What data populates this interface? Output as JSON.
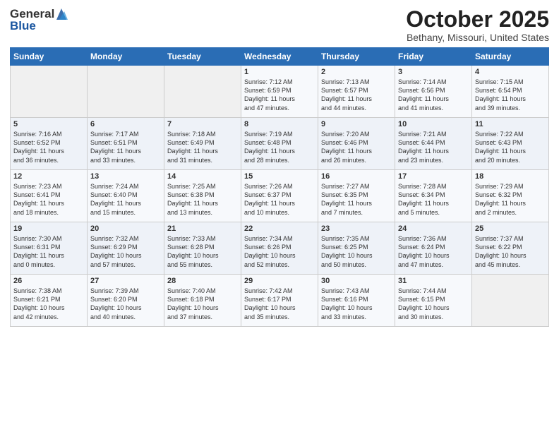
{
  "header": {
    "logo_line1": "General",
    "logo_line2": "Blue",
    "month": "October 2025",
    "location": "Bethany, Missouri, United States"
  },
  "days_of_week": [
    "Sunday",
    "Monday",
    "Tuesday",
    "Wednesday",
    "Thursday",
    "Friday",
    "Saturday"
  ],
  "weeks": [
    [
      {
        "day": "",
        "info": ""
      },
      {
        "day": "",
        "info": ""
      },
      {
        "day": "",
        "info": ""
      },
      {
        "day": "1",
        "info": "Sunrise: 7:12 AM\nSunset: 6:59 PM\nDaylight: 11 hours\nand 47 minutes."
      },
      {
        "day": "2",
        "info": "Sunrise: 7:13 AM\nSunset: 6:57 PM\nDaylight: 11 hours\nand 44 minutes."
      },
      {
        "day": "3",
        "info": "Sunrise: 7:14 AM\nSunset: 6:56 PM\nDaylight: 11 hours\nand 41 minutes."
      },
      {
        "day": "4",
        "info": "Sunrise: 7:15 AM\nSunset: 6:54 PM\nDaylight: 11 hours\nand 39 minutes."
      }
    ],
    [
      {
        "day": "5",
        "info": "Sunrise: 7:16 AM\nSunset: 6:52 PM\nDaylight: 11 hours\nand 36 minutes."
      },
      {
        "day": "6",
        "info": "Sunrise: 7:17 AM\nSunset: 6:51 PM\nDaylight: 11 hours\nand 33 minutes."
      },
      {
        "day": "7",
        "info": "Sunrise: 7:18 AM\nSunset: 6:49 PM\nDaylight: 11 hours\nand 31 minutes."
      },
      {
        "day": "8",
        "info": "Sunrise: 7:19 AM\nSunset: 6:48 PM\nDaylight: 11 hours\nand 28 minutes."
      },
      {
        "day": "9",
        "info": "Sunrise: 7:20 AM\nSunset: 6:46 PM\nDaylight: 11 hours\nand 26 minutes."
      },
      {
        "day": "10",
        "info": "Sunrise: 7:21 AM\nSunset: 6:44 PM\nDaylight: 11 hours\nand 23 minutes."
      },
      {
        "day": "11",
        "info": "Sunrise: 7:22 AM\nSunset: 6:43 PM\nDaylight: 11 hours\nand 20 minutes."
      }
    ],
    [
      {
        "day": "12",
        "info": "Sunrise: 7:23 AM\nSunset: 6:41 PM\nDaylight: 11 hours\nand 18 minutes."
      },
      {
        "day": "13",
        "info": "Sunrise: 7:24 AM\nSunset: 6:40 PM\nDaylight: 11 hours\nand 15 minutes."
      },
      {
        "day": "14",
        "info": "Sunrise: 7:25 AM\nSunset: 6:38 PM\nDaylight: 11 hours\nand 13 minutes."
      },
      {
        "day": "15",
        "info": "Sunrise: 7:26 AM\nSunset: 6:37 PM\nDaylight: 11 hours\nand 10 minutes."
      },
      {
        "day": "16",
        "info": "Sunrise: 7:27 AM\nSunset: 6:35 PM\nDaylight: 11 hours\nand 7 minutes."
      },
      {
        "day": "17",
        "info": "Sunrise: 7:28 AM\nSunset: 6:34 PM\nDaylight: 11 hours\nand 5 minutes."
      },
      {
        "day": "18",
        "info": "Sunrise: 7:29 AM\nSunset: 6:32 PM\nDaylight: 11 hours\nand 2 minutes."
      }
    ],
    [
      {
        "day": "19",
        "info": "Sunrise: 7:30 AM\nSunset: 6:31 PM\nDaylight: 11 hours\nand 0 minutes."
      },
      {
        "day": "20",
        "info": "Sunrise: 7:32 AM\nSunset: 6:29 PM\nDaylight: 10 hours\nand 57 minutes."
      },
      {
        "day": "21",
        "info": "Sunrise: 7:33 AM\nSunset: 6:28 PM\nDaylight: 10 hours\nand 55 minutes."
      },
      {
        "day": "22",
        "info": "Sunrise: 7:34 AM\nSunset: 6:26 PM\nDaylight: 10 hours\nand 52 minutes."
      },
      {
        "day": "23",
        "info": "Sunrise: 7:35 AM\nSunset: 6:25 PM\nDaylight: 10 hours\nand 50 minutes."
      },
      {
        "day": "24",
        "info": "Sunrise: 7:36 AM\nSunset: 6:24 PM\nDaylight: 10 hours\nand 47 minutes."
      },
      {
        "day": "25",
        "info": "Sunrise: 7:37 AM\nSunset: 6:22 PM\nDaylight: 10 hours\nand 45 minutes."
      }
    ],
    [
      {
        "day": "26",
        "info": "Sunrise: 7:38 AM\nSunset: 6:21 PM\nDaylight: 10 hours\nand 42 minutes."
      },
      {
        "day": "27",
        "info": "Sunrise: 7:39 AM\nSunset: 6:20 PM\nDaylight: 10 hours\nand 40 minutes."
      },
      {
        "day": "28",
        "info": "Sunrise: 7:40 AM\nSunset: 6:18 PM\nDaylight: 10 hours\nand 37 minutes."
      },
      {
        "day": "29",
        "info": "Sunrise: 7:42 AM\nSunset: 6:17 PM\nDaylight: 10 hours\nand 35 minutes."
      },
      {
        "day": "30",
        "info": "Sunrise: 7:43 AM\nSunset: 6:16 PM\nDaylight: 10 hours\nand 33 minutes."
      },
      {
        "day": "31",
        "info": "Sunrise: 7:44 AM\nSunset: 6:15 PM\nDaylight: 10 hours\nand 30 minutes."
      },
      {
        "day": "",
        "info": ""
      }
    ]
  ]
}
